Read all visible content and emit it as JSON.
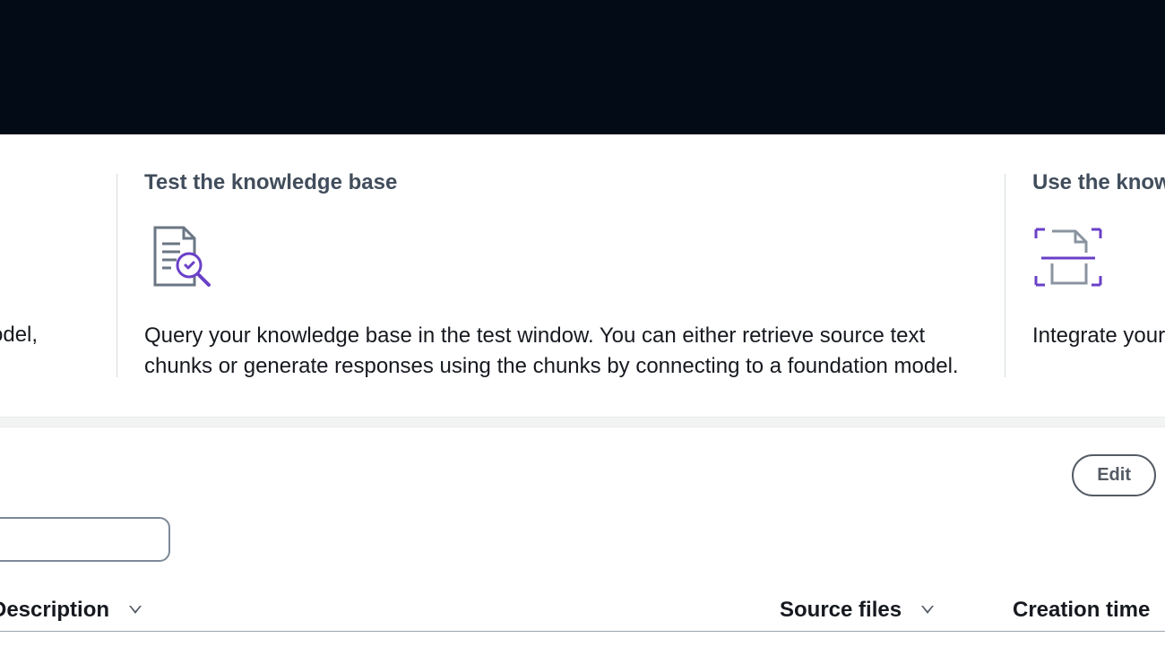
{
  "left_fragment_text": "model,",
  "cards": {
    "test": {
      "title": "Test the knowledge base",
      "description": "Query your knowledge base in the test window. You can either retrieve source text chunks or generate responses using the chunks by connecting to a foundation model."
    },
    "use": {
      "title_fragment": "Use the knowl",
      "description_fragment": "Integrate your "
    }
  },
  "panel": {
    "edit_label": "Edit"
  },
  "table": {
    "columns": {
      "description": "Description",
      "source_files": "Source files",
      "creation_time": "Creation time"
    }
  }
}
